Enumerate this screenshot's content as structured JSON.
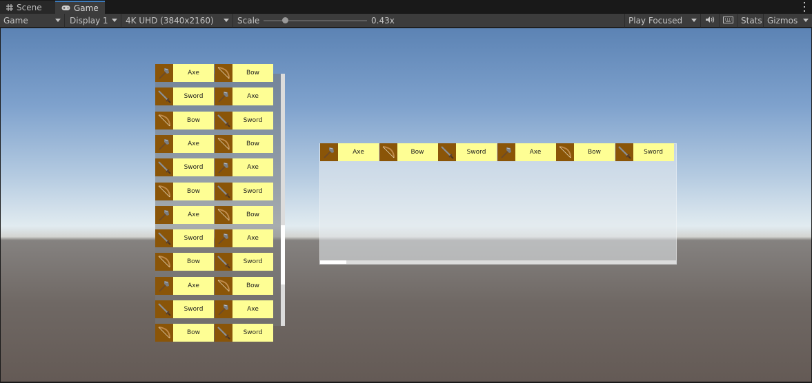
{
  "tabs": [
    {
      "label": "Scene",
      "icon": "grid-icon",
      "active": false
    },
    {
      "label": "Game",
      "icon": "gamepad-icon",
      "active": true
    }
  ],
  "toolbar": {
    "view_mode": "Game",
    "display": "Display 1",
    "resolution": "4K UHD (3840x2160)",
    "scale_label": "Scale",
    "scale_value": "0.43x",
    "scale_fraction": 0.2,
    "play_mode": "Play Focused",
    "stats": "Stats",
    "gizmos": "Gizmos"
  },
  "vertical_list": {
    "rows": [
      [
        "Axe",
        "Bow"
      ],
      [
        "Sword",
        "Axe"
      ],
      [
        "Bow",
        "Sword"
      ],
      [
        "Axe",
        "Bow"
      ],
      [
        "Sword",
        "Axe"
      ],
      [
        "Bow",
        "Sword"
      ],
      [
        "Axe",
        "Bow"
      ],
      [
        "Sword",
        "Axe"
      ],
      [
        "Bow",
        "Sword"
      ],
      [
        "Axe",
        "Bow"
      ],
      [
        "Sword",
        "Axe"
      ],
      [
        "Bow",
        "Sword"
      ]
    ],
    "scroll_position": 0.6
  },
  "horizontal_list": {
    "items": [
      "Axe",
      "Bow",
      "Sword",
      "Axe",
      "Bow",
      "Sword"
    ],
    "scroll_position": 0.0
  },
  "colors": {
    "item_icon_bg": "#8a5508",
    "item_label_bg": "#fefe94",
    "tab_accent": "#3a79bb"
  }
}
